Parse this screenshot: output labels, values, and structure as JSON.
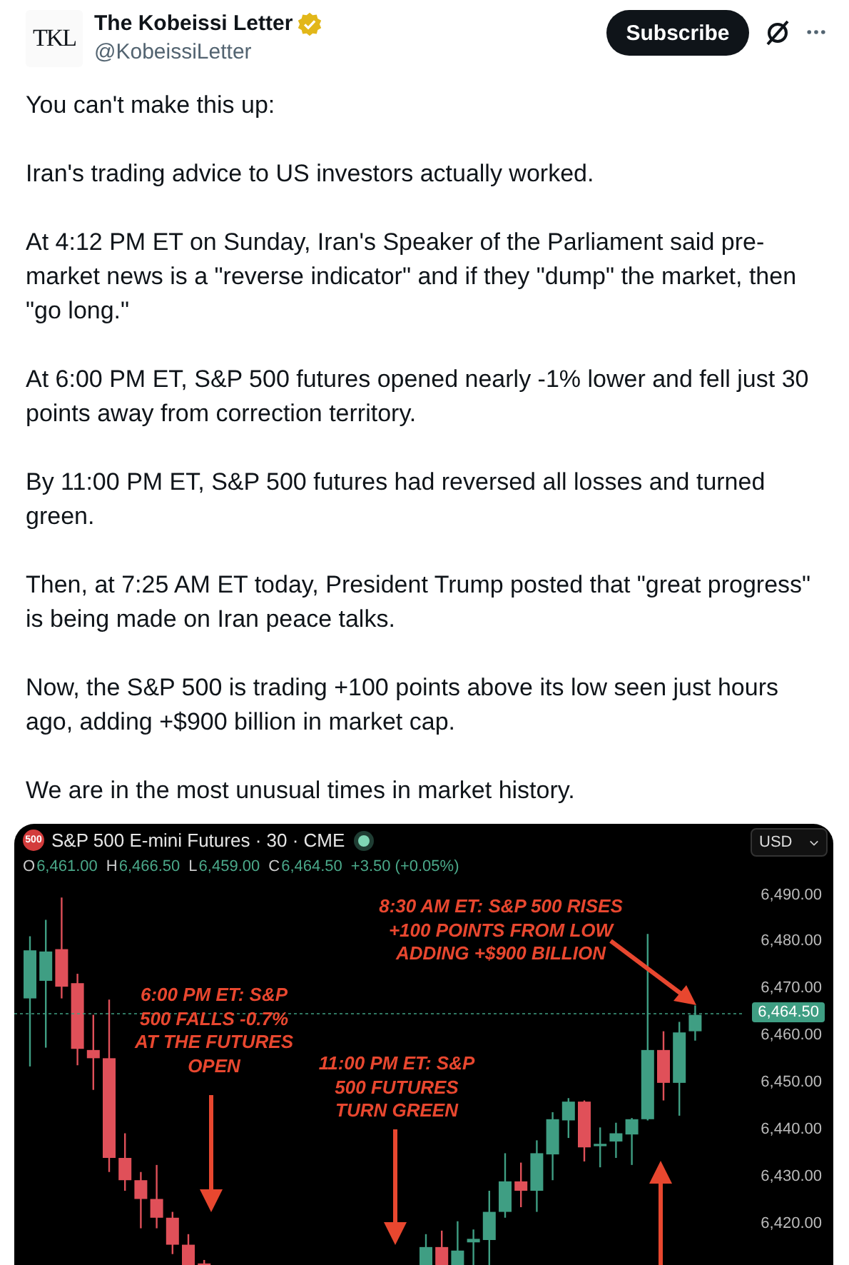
{
  "author": {
    "name": "The Kobeissi Letter",
    "handle": "@KobeissiLetter",
    "logo": "TKL",
    "verified": true
  },
  "actions": {
    "subscribe": "Subscribe"
  },
  "paragraphs": [
    "You can't make this up:",
    "Iran's trading advice to US investors actually worked.",
    "At 4:12 PM ET on Sunday, Iran's Speaker of the Parliament said pre-market news is a \"reverse indicator\" and if they \"dump\" the market, then \"go long.\"",
    "At 6:00 PM ET, S&P 500 futures opened nearly -1% lower and fell just 30 points away from correction territory.",
    "By 11:00 PM ET, S&P 500 futures had reversed all losses and turned green.",
    "Then, at 7:25 AM ET today, President Trump posted that \"great progress\" is being made on Iran peace talks.",
    "Now, the S&P 500 is trading +100 points above its low seen just hours ago, adding +$900 billion in market cap.",
    "We are in the most unusual times in market history."
  ],
  "chart": {
    "badge": "500",
    "title": "S&P 500 E-mini Futures · 30 · CME",
    "currency": "USD",
    "ohlc": [
      {
        "label": "O",
        "value": "6,461.00"
      },
      {
        "label": "H",
        "value": "6,466.50"
      },
      {
        "label": "L",
        "value": "6,459.00"
      },
      {
        "label": "C",
        "value": "6,464.50"
      },
      {
        "value": "+3.50 (+0.05%)"
      }
    ],
    "last_price": "6,464.50",
    "annotations": [
      [
        "8:30 AM ET: S&P 500 RISES",
        "+100 POINTS FROM LOW",
        "ADDING +$900 BILLION"
      ],
      [
        "6:00 PM ET: S&P",
        "500 FALLS -0.7%",
        "AT THE FUTURES",
        "OPEN"
      ],
      [
        "11:00 PM ET: S&P",
        "500 FUTURES",
        "TURN GREEN"
      ]
    ],
    "chart_data": {
      "type": "candlestick",
      "categories": [
        null,
        null,
        null,
        null,
        null,
        null,
        null,
        null,
        null,
        null,
        null,
        null,
        null,
        null,
        null,
        null,
        null,
        null,
        null,
        null,
        null,
        null,
        null,
        null,
        null,
        null,
        null,
        null,
        null,
        null,
        null,
        null,
        null,
        null,
        null,
        null,
        null,
        null,
        null,
        null,
        null,
        null,
        null
      ],
      "ohlc": [
        [
          6468.0,
          6481.25,
          6453.5,
          6478.25
        ],
        [
          6471.75,
          6484.75,
          6457.5,
          6478.0
        ],
        [
          6478.5,
          6489.5,
          6468.0,
          6470.5
        ],
        [
          6471.25,
          6473.25,
          6453.75,
          6457.25
        ],
        [
          6457.0,
          6464.5,
          6448.5,
          6455.25
        ],
        [
          6455.25,
          6467.75,
          6431.0,
          6434.0
        ],
        [
          6434.0,
          6439.25,
          6427.0,
          6429.25
        ],
        [
          6429.25,
          6431.0,
          6419.0,
          6425.25
        ],
        [
          6425.25,
          6432.5,
          6419.0,
          6421.25
        ],
        [
          6421.25,
          6422.5,
          6413.5,
          6415.5
        ],
        [
          6415.5,
          6417.75,
          6410.5,
          6410.5
        ],
        [
          6411.5,
          6412.25,
          6410.5,
          6410.5
        ],
        null,
        null,
        null,
        null,
        null,
        null,
        null,
        null,
        null,
        null,
        null,
        null,
        null,
        [
          6410.5,
          6417.75,
          6410.5,
          6415.0
        ],
        [
          6415.0,
          6418.5,
          6410.5,
          6410.5
        ],
        [
          6410.5,
          6420.5,
          6410.5,
          6414.25
        ],
        [
          6416.0,
          6418.75,
          6410.5,
          6416.75
        ],
        [
          6416.5,
          6427.0,
          6410.5,
          6422.5
        ],
        [
          6422.5,
          6435.0,
          6421.25,
          6429.0
        ],
        [
          6429.0,
          6433.0,
          6423.5,
          6427.0
        ],
        [
          6427.0,
          6437.75,
          6422.5,
          6435.0
        ],
        [
          6434.75,
          6443.75,
          6429.25,
          6442.25
        ],
        [
          6442.0,
          6446.75,
          6438.25,
          6446.0
        ],
        [
          6446.0,
          6446.25,
          6433.25,
          6436.25
        ],
        [
          6436.5,
          6440.5,
          6432.0,
          6437.0
        ],
        [
          6437.5,
          6441.5,
          6434.0,
          6439.25
        ],
        [
          6439.0,
          6442.5,
          6432.5,
          6442.25
        ],
        [
          6442.25,
          6481.75,
          6442.0,
          6457.0
        ],
        [
          6457.0,
          6461.0,
          6446.25,
          6450.0
        ],
        [
          6450.0,
          6463.0,
          6443.0,
          6460.75
        ],
        [
          6461.0,
          6466.5,
          6459.0,
          6464.5
        ]
      ],
      "ylim": [
        6420,
        6490
      ],
      "yticks": [
        {
          "value": 6490,
          "label": "6,490.00"
        },
        {
          "value": 6480,
          "label": "6,480.00"
        },
        {
          "value": 6470,
          "label": "6,470.00"
        },
        {
          "value": 6460,
          "label": "6,460.00"
        },
        {
          "value": 6450,
          "label": "6,450.00"
        },
        {
          "value": 6440,
          "label": "6,440.00"
        },
        {
          "value": 6430,
          "label": "6,430.00"
        },
        {
          "value": 6420,
          "label": "6,420.00"
        }
      ]
    }
  }
}
